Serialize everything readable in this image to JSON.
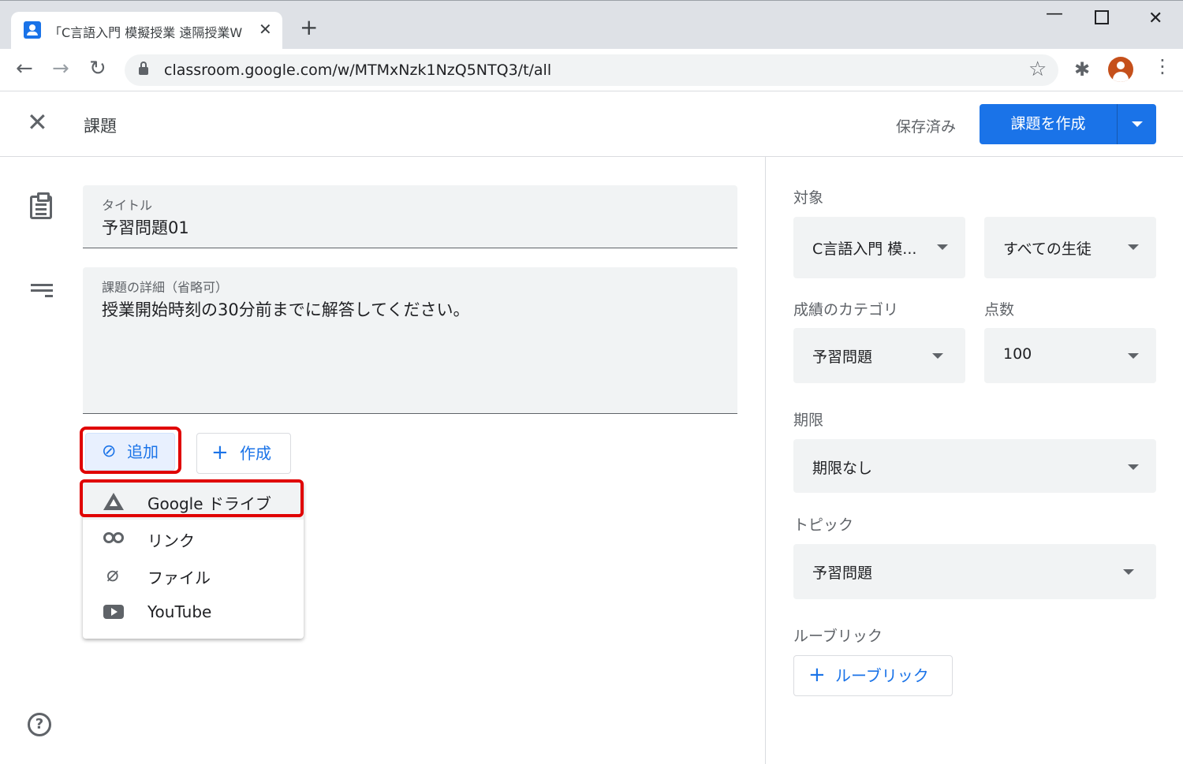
{
  "browser": {
    "tab_title": "「C言語入門 模擬授業 遠隔授業W",
    "url": "classroom.google.com/w/MTMxNzk1NzQ5NTQ3/t/all"
  },
  "header": {
    "title": "課題",
    "saved_status": "保存済み",
    "create_label": "課題を作成"
  },
  "form": {
    "title_label": "タイトル",
    "title_value": "予習問題01",
    "details_label": "課題の詳細（省略可）",
    "details_value": "授業開始時刻の30分前までに解答してください。"
  },
  "attach": {
    "add_label": "追加",
    "create_label": "作成",
    "menu": [
      {
        "label": "Google ドライブ",
        "icon": "google-drive-icon"
      },
      {
        "label": "リンク",
        "icon": "link-icon"
      },
      {
        "label": "ファイル",
        "icon": "paperclip-icon"
      },
      {
        "label": "YouTube",
        "icon": "youtube-icon"
      }
    ]
  },
  "sidebar": {
    "target_label": "対象",
    "class_value": "C言語入門 模...",
    "students_value": "すべての生徒",
    "category_label": "成績のカテゴリ",
    "category_value": "予習問題",
    "points_label": "点数",
    "points_value": "100",
    "due_label": "期限",
    "due_value": "期限なし",
    "topic_label": "トピック",
    "topic_value": "予習問題",
    "rubric_label": "ルーブリック",
    "rubric_button": "ルーブリック"
  },
  "colors": {
    "accent": "#1a73e8",
    "highlight": "#e00000"
  }
}
